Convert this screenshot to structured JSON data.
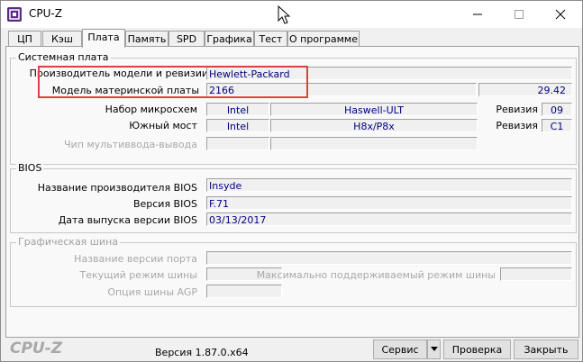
{
  "window": {
    "title": "CPU-Z"
  },
  "tabs": [
    {
      "label": "ЦП"
    },
    {
      "label": "Кэш"
    },
    {
      "label": "Плата"
    },
    {
      "label": "Память"
    },
    {
      "label": "SPD"
    },
    {
      "label": "Графика"
    },
    {
      "label": "Тест"
    },
    {
      "label": "О программе"
    }
  ],
  "motherboard": {
    "group_title": "Системная плата",
    "manufacturer_label": "Производитель модели и ревизии",
    "manufacturer_value": "Hewlett-Packard",
    "model_label": "Модель материнской платы",
    "model_value": "2166",
    "model_revision": "29.42",
    "chipset_label": "Набор микросхем",
    "chipset_vendor": "Intel",
    "chipset_model": "Haswell-ULT",
    "chipset_rev_label": "Ревизия",
    "chipset_rev": "09",
    "southbridge_label": "Южный мост",
    "southbridge_vendor": "Intel",
    "southbridge_model": "H8x/P8x",
    "southbridge_rev_label": "Ревизия",
    "southbridge_rev": "C1",
    "lpcio_label": "Чип мультиввода-вывода"
  },
  "bios": {
    "group_title": "BIOS",
    "brand_label": "Название производителя BIOS",
    "brand_value": "Insyde",
    "version_label": "Версия BIOS",
    "version_value": "F.71",
    "date_label": "Дата выпуска версии BIOS",
    "date_value": "03/13/2017"
  },
  "graphic_bus": {
    "group_title": "Графическая шина",
    "port_label": "Название версии порта",
    "link_width_label": "Текущий режим шины",
    "max_supported_label": "Максимально поддерживаемый режим шины",
    "agp_label": "Опция шины AGP"
  },
  "footer": {
    "logo": "CPU-Z",
    "version": "Версия 1.87.0.x64",
    "service_label": "Сервис",
    "validate_label": "Проверка",
    "close_label": "Закрыть"
  },
  "colors": {
    "value_text": "#000080",
    "highlight": "#e04040",
    "app_icon": "#5b2a86"
  }
}
